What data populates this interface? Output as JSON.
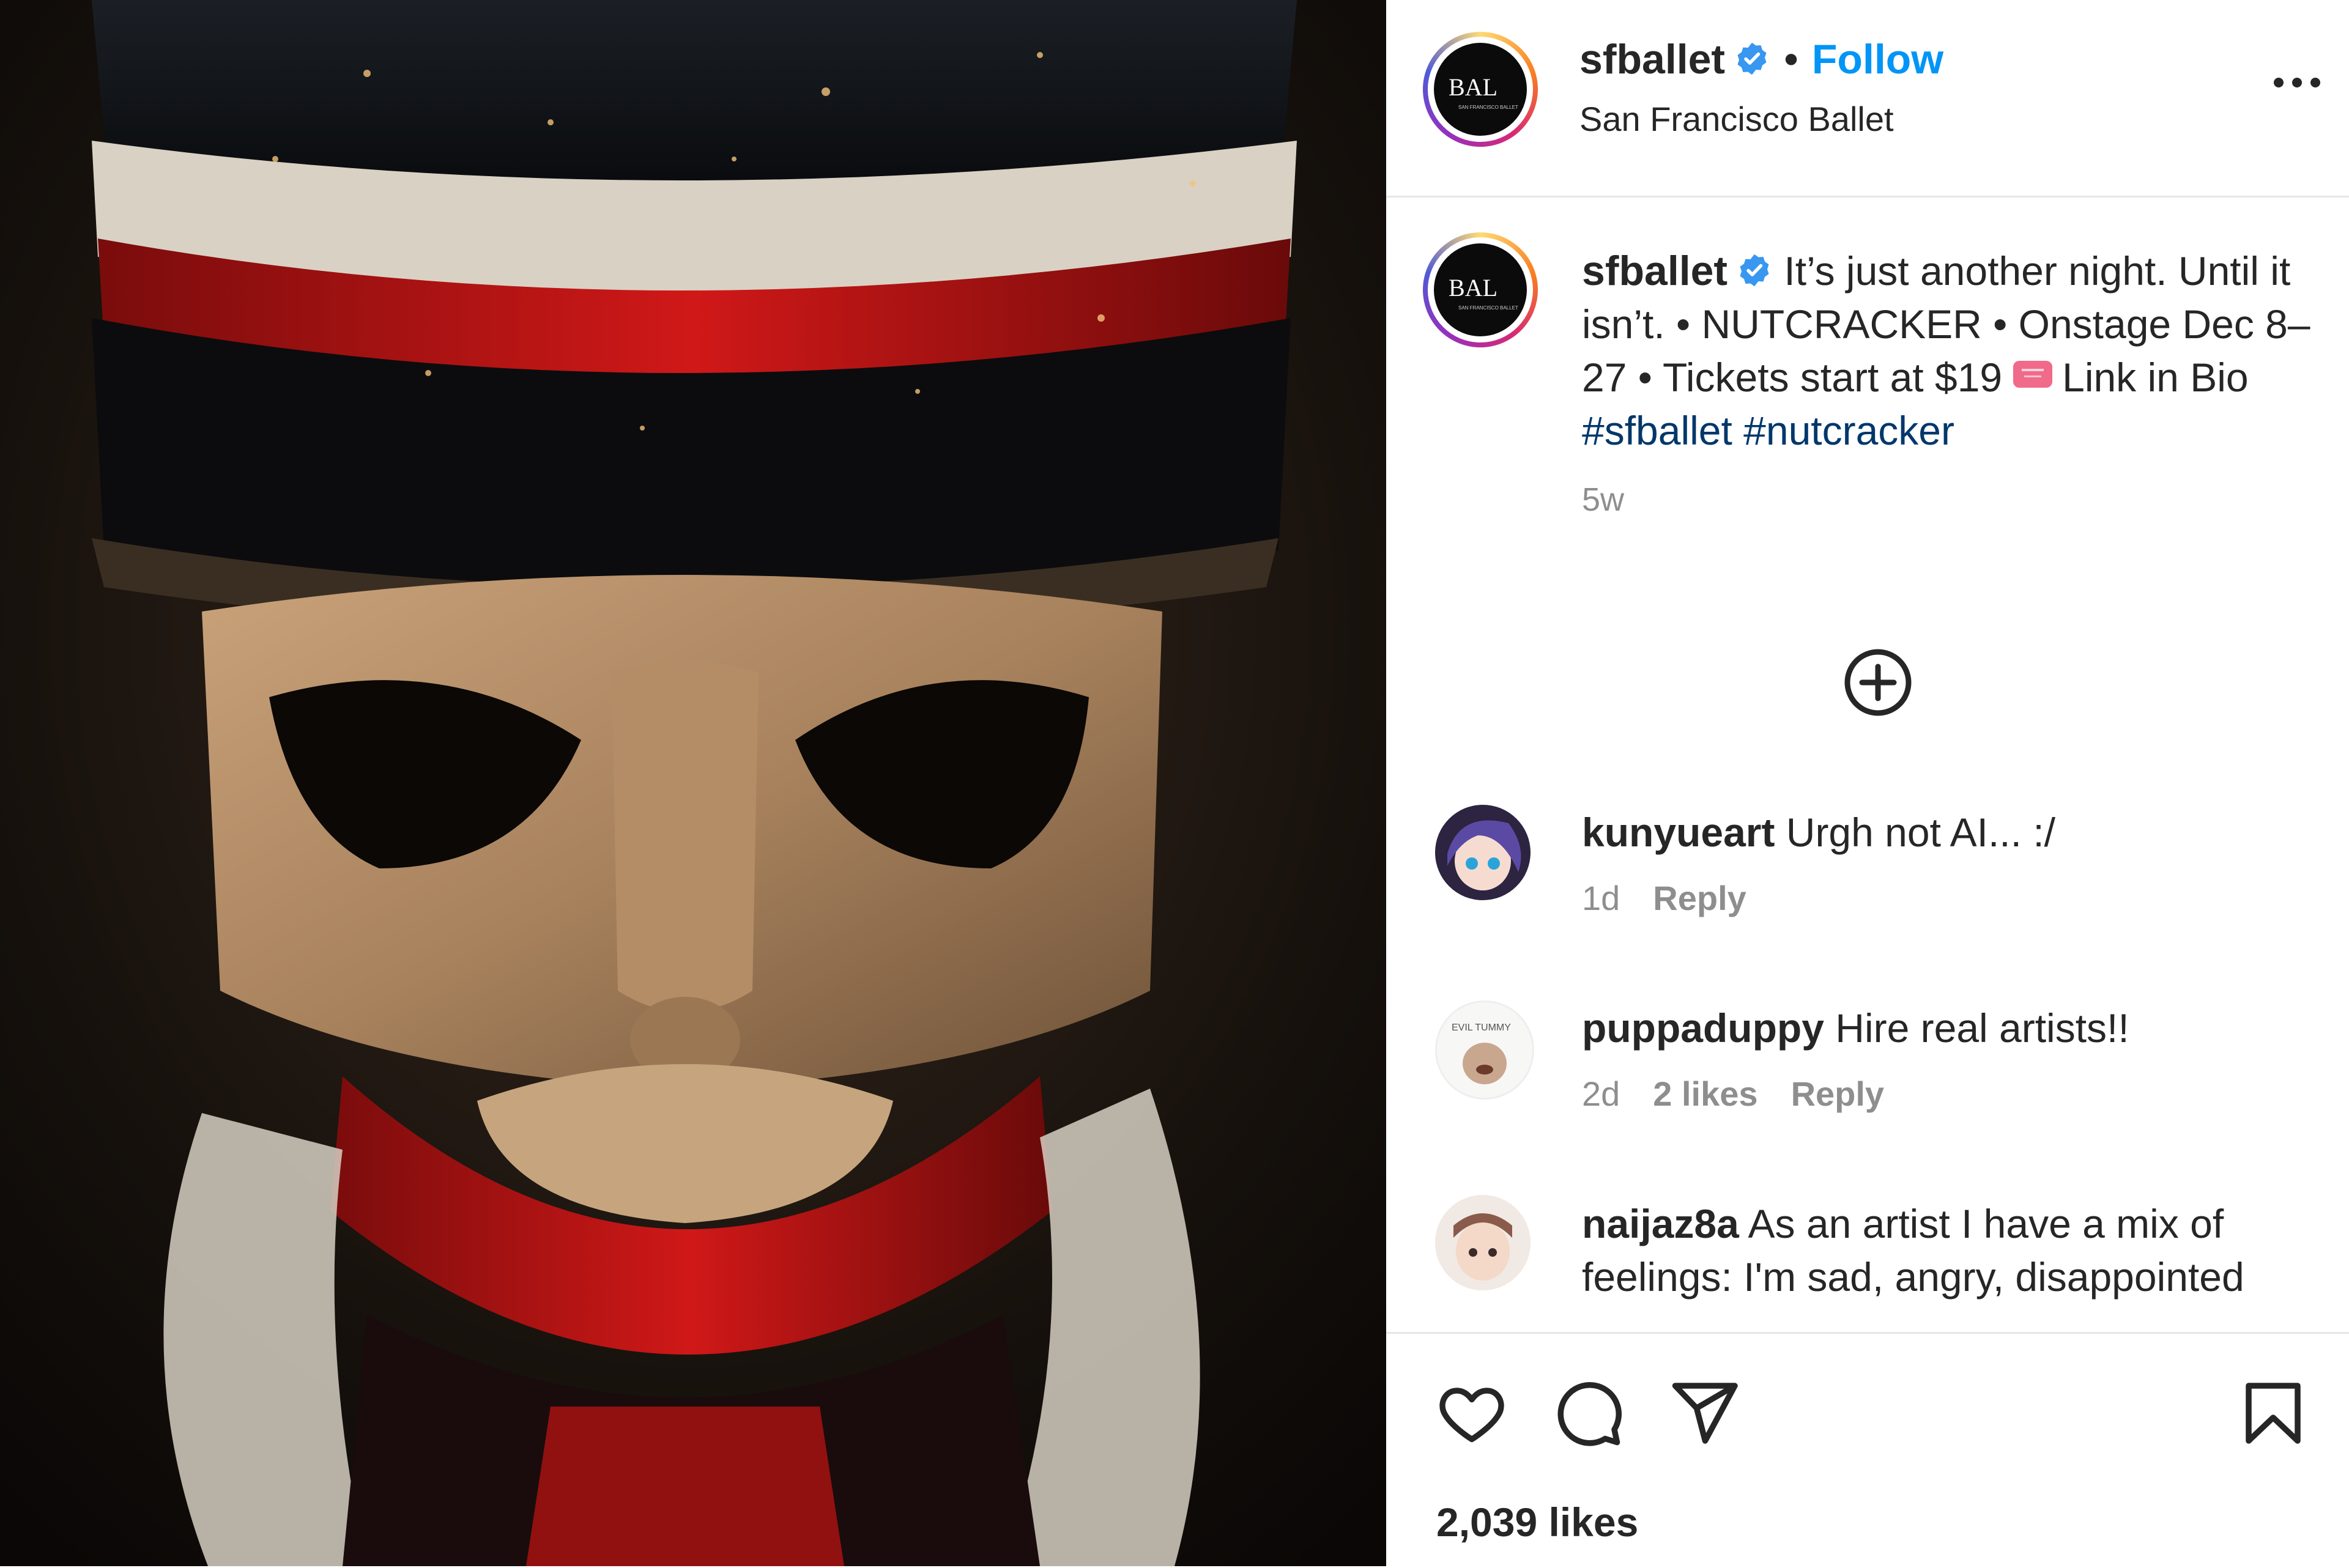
{
  "post": {
    "username": "sfballet",
    "follow_label": "Follow",
    "location": "San Francisco Ballet",
    "caption_text_1": "It’s just another night. Until it isn’t. • NUTCRACKER • Onstage Dec 8–27 • Tickets start at $19",
    "caption_text_2": "Link in Bio",
    "hashtag_1": "#sfballet",
    "hashtag_2": "#nutcracker",
    "age": "5w",
    "likes": "2,039 likes"
  },
  "comments": [
    {
      "username": "kunyueart",
      "text": "Urgh not AI... :/",
      "age": "1d",
      "likes": "",
      "reply": "Reply"
    },
    {
      "username": "puppaduppy",
      "text": "Hire real artists!!",
      "age": "2d",
      "likes": "2 likes",
      "reply": "Reply"
    },
    {
      "username": "naijaz8a",
      "text": "As an artist I have a mix of feelings: I'm sad, angry, disappointed",
      "age": "",
      "likes": "",
      "reply": ""
    }
  ],
  "icons": {
    "verified": "verified-badge-icon",
    "more": "more-options-icon",
    "load_more": "add-circle-icon",
    "like": "heart-icon",
    "comment": "comment-icon",
    "share": "send-icon",
    "save": "bookmark-icon"
  },
  "colors": {
    "link_blue": "#0095f6",
    "hashtag_blue": "#00376b",
    "muted": "#8e8e8e",
    "text": "#262626"
  }
}
